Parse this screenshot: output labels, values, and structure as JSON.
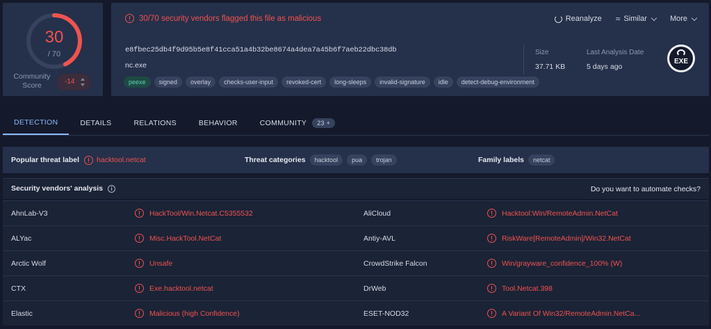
{
  "score": {
    "detections": "30",
    "total": "/ 70",
    "detected_fraction": 0.4286,
    "community_label": "Community Score",
    "community_value": "-14"
  },
  "header": {
    "flag_message": "30/70 security vendors flagged this file as malicious",
    "actions": {
      "reanalyze": "Reanalyze",
      "similar": "Similar",
      "more": "More"
    },
    "hash": "e8fbec25db4f9d95b5e8f41cca51a4b32be8674a4dea7a45b6f7aeb22dbc38db",
    "filename": "nc.exe",
    "tags": [
      "peexe",
      "signed",
      "overlay",
      "checks-user-input",
      "revoked-cert",
      "long-sleeps",
      "invalid-signature",
      "idle",
      "detect-debug-environment"
    ],
    "size_label": "Size",
    "size_value": "37.71 KB",
    "analysis_label": "Last Analysis Date",
    "analysis_value": "5 days ago",
    "file_type": "EXE"
  },
  "tabs": [
    {
      "label": "DETECTION",
      "active": true
    },
    {
      "label": "DETAILS"
    },
    {
      "label": "RELATIONS"
    },
    {
      "label": "BEHAVIOR"
    },
    {
      "label": "COMMUNITY",
      "badge": "23 +"
    }
  ],
  "threat": {
    "popular_label": "Popular threat label",
    "popular_value": "hacktool.netcat",
    "categories_label": "Threat categories",
    "categories": [
      "hacktool",
      "pua",
      "trojan"
    ],
    "family_label": "Family labels",
    "families": [
      "netcat"
    ]
  },
  "vendors": {
    "title": "Security vendors' analysis",
    "automate": "Do you want to automate checks?",
    "rows": [
      {
        "v1": "AhnLab-V3",
        "r1": "HackTool/Win.Netcat.C5355532",
        "v2": "AliCloud",
        "r2": "Hacktool:Win/RemoteAdmin.NetCat"
      },
      {
        "v1": "ALYac",
        "r1": "Misc.HackTool.NetCat",
        "v2": "Antiy-AVL",
        "r2": "RiskWare[RemoteAdmin]/Win32.NetCat"
      },
      {
        "v1": "Arctic Wolf",
        "r1": "Unsafe",
        "v2": "CrowdStrike Falcon",
        "r2": "Win/grayware_confidence_100% (W)"
      },
      {
        "v1": "CTX",
        "r1": "Exe.hacktool.netcat",
        "v2": "DrWeb",
        "r2": "Tool.Netcat.398"
      },
      {
        "v1": "Elastic",
        "r1": "Malicious (high Confidence)",
        "v2": "ESET-NOD32",
        "r2": "A Variant Of Win32/RemoteAdmin.NetCa..."
      }
    ]
  },
  "colors": {
    "alert": "#ef5350",
    "accent": "#8fb7ff",
    "panel": "#25304a",
    "background": "#141a2b"
  }
}
